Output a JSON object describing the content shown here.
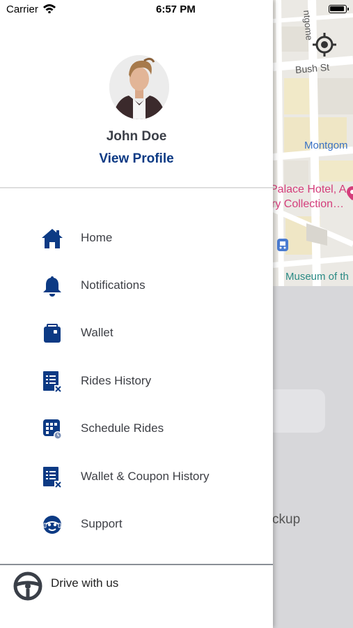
{
  "status_bar": {
    "carrier": "Carrier",
    "time": "6:57 PM"
  },
  "map": {
    "street_bush": "Bush St",
    "street_montgomery": "Montgom",
    "street_montgomery_vertical": "ntgome",
    "poi_hotel_line1": "Palace Hotel, A",
    "poi_hotel_line2": "ry Collection…",
    "poi_museum": "Museum of th",
    "pickup_label": "ckup"
  },
  "drawer": {
    "user_name": "John Doe",
    "view_profile": "View Profile",
    "menu": [
      {
        "label": "Home",
        "icon": "home-icon"
      },
      {
        "label": "Notifications",
        "icon": "bell-icon"
      },
      {
        "label": "Wallet",
        "icon": "wallet-icon"
      },
      {
        "label": "Rides History",
        "icon": "history-icon"
      },
      {
        "label": "Schedule Rides",
        "icon": "schedule-icon"
      },
      {
        "label": "Wallet & Coupon History",
        "icon": "coupon-history-icon"
      },
      {
        "label": "Support",
        "icon": "support-icon"
      }
    ],
    "drive_label": "Drive with us"
  },
  "colors": {
    "brand": "#0c3a84",
    "map_pink": "#d43d7b",
    "map_blue": "#3a72c4"
  }
}
